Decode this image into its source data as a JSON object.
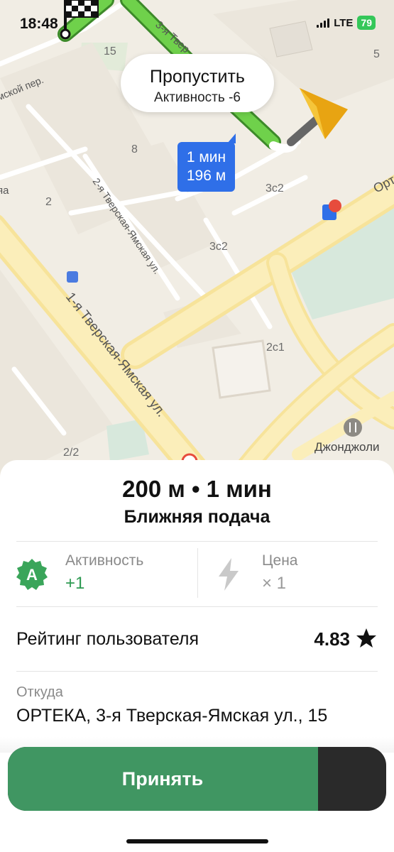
{
  "status_bar": {
    "time": "18:48",
    "network": "LTE",
    "battery": "79"
  },
  "map": {
    "skip_button": {
      "title": "Пропустить",
      "subtitle": "Активность -6"
    },
    "eta": {
      "time": "1 мин",
      "distance": "196 м"
    },
    "street_labels": [
      "3-я Твер",
      "мской пер.",
      "2-я Тверская-Ямская ул.",
      "1-я Тверская-Ямская ул.",
      "Орт",
      "яа"
    ],
    "building_labels": [
      "15",
      "5",
      "8",
      "2",
      "3с2",
      "3с2",
      "2с1",
      "2/2"
    ],
    "poi_label": "Джонджоли"
  },
  "order": {
    "distance_time": "200 м • 1 мин",
    "type": "Ближняя подача",
    "activity": {
      "badge": "A",
      "label": "Активность",
      "value": "+1"
    },
    "price": {
      "label": "Цена",
      "value": "× 1"
    },
    "rating": {
      "label": "Рейтинг пользователя",
      "value": "4.83"
    },
    "from": {
      "label": "Откуда",
      "address": "ОРТЕКА, 3-я Тверская-Ямская ул., 15"
    }
  },
  "accept": {
    "label": "Принять",
    "progress": 0.82
  },
  "colors": {
    "route": "#6fd14b",
    "accent_blue": "#2f6fe8",
    "accept_green": "#409662",
    "activity_green": "#2e9a52"
  }
}
